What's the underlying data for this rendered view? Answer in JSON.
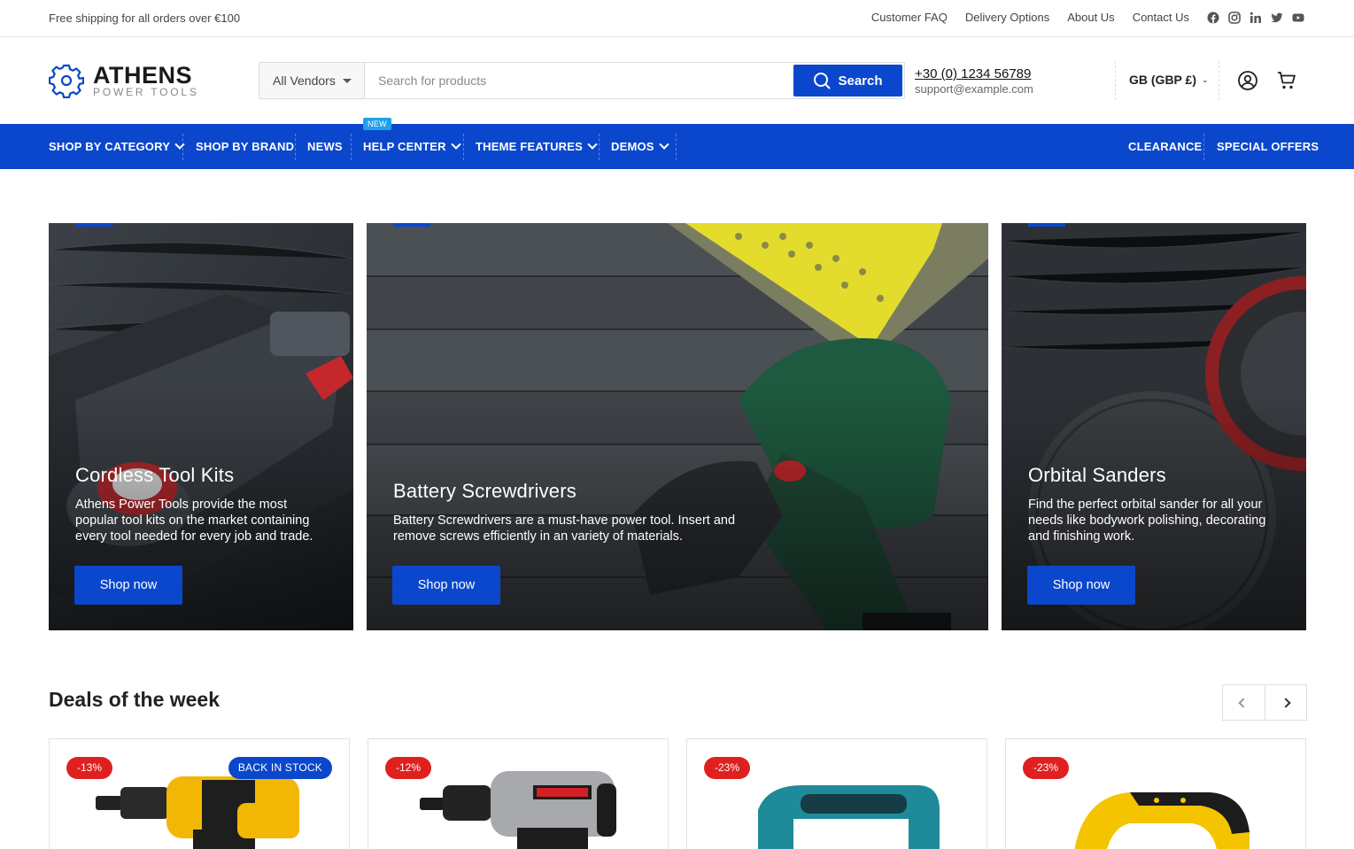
{
  "topbar": {
    "shipping": "Free shipping for all orders over €100",
    "links": [
      "Customer FAQ",
      "Delivery Options",
      "About Us",
      "Contact Us"
    ],
    "social_icons": [
      "facebook-icon",
      "instagram-icon",
      "linkedin-icon",
      "twitter-icon",
      "youtube-icon"
    ]
  },
  "logo": {
    "name": "ATHENS",
    "tagline": "POWER TOOLS"
  },
  "search": {
    "vendor": "All Vendors",
    "placeholder": "Search for products",
    "button": "Search"
  },
  "contact": {
    "phone": "+30 (0) 1234 56789",
    "email": "support@example.com"
  },
  "currency": "GB (GBP £)",
  "nav": {
    "left": [
      {
        "label": "SHOP BY CATEGORY",
        "dropdown": true
      },
      {
        "label": "SHOP BY BRAND",
        "dropdown": false
      },
      {
        "label": "NEWS",
        "dropdown": false
      },
      {
        "label": "HELP CENTER",
        "dropdown": true
      },
      {
        "label": "THEME FEATURES",
        "dropdown": true
      },
      {
        "label": "DEMOS",
        "dropdown": true
      }
    ],
    "right": [
      "CLEARANCE",
      "SPECIAL OFFERS"
    ],
    "new_badge": "NEW"
  },
  "banners": [
    {
      "title": "Cordless Tool Kits",
      "text": "Athens Power Tools provide the most popular tool kits on the market containing every tool needed for every job and trade.",
      "button": "Shop now"
    },
    {
      "title": "Battery Screwdrivers",
      "text": "Battery Screwdrivers are a must-have power tool. Insert and remove screws efficiently in an variety of materials.",
      "button": "Shop now"
    },
    {
      "title": "Orbital Sanders",
      "text": "Find the perfect orbital sander for all your needs like bodywork polishing, decorating and finishing work.",
      "button": "Shop now"
    }
  ],
  "deals": {
    "title": "Deals of the week",
    "products": [
      {
        "discount": "-13%",
        "badge": "BACK IN STOCK"
      },
      {
        "discount": "-12%",
        "badge": ""
      },
      {
        "discount": "-23%",
        "badge": ""
      },
      {
        "discount": "-23%",
        "badge": ""
      }
    ]
  },
  "colors": {
    "brand_blue": "#0a47cc",
    "discount_red": "#e0201f",
    "new_badge": "#1ea0ea"
  }
}
